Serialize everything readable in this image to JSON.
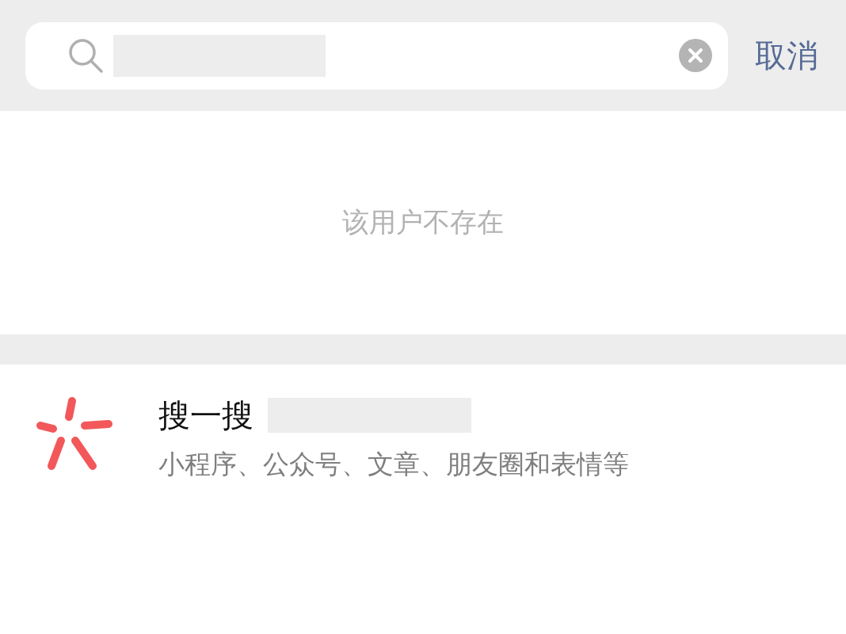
{
  "search_bar": {
    "value_redacted": true,
    "cancel_label": "取消"
  },
  "message": "该用户不存在",
  "search_entry": {
    "title": "搜一搜",
    "term_redacted": true,
    "subtitle": "小程序、公众号、文章、朋友圈和表情等"
  }
}
